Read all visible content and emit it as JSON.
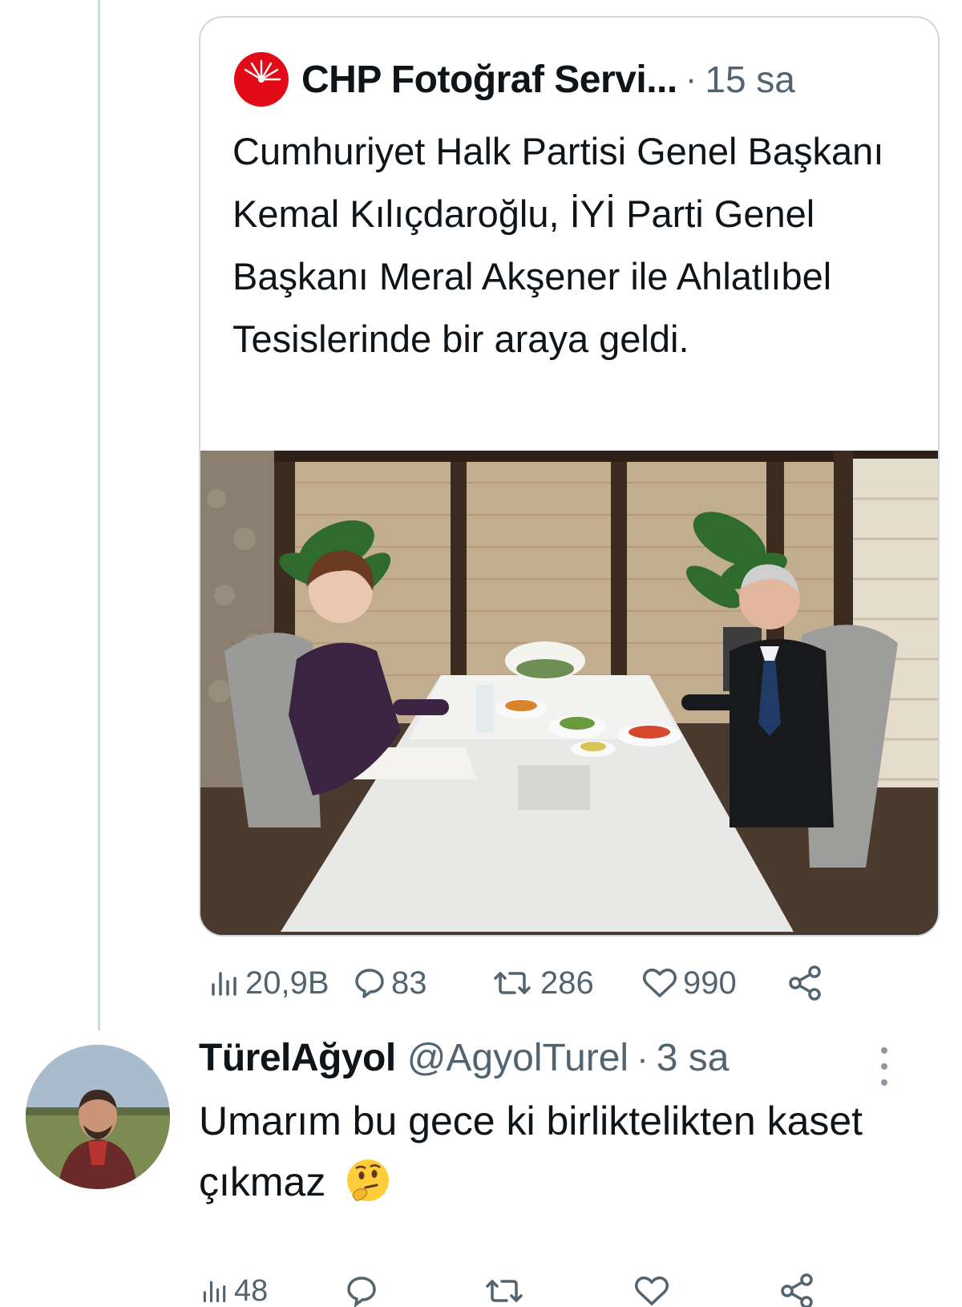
{
  "quoted_tweet": {
    "author_name": "CHP Fotoğraf Servi...",
    "separator": "·",
    "time": "15 sa",
    "text": "Cumhuriyet Halk Partisi Genel Başkanı Kemal Kılıçdaroğlu, İYİ Parti Genel Başkanı Meral Akşener ile Ahlatlıbel Tesislerinde bir araya geldi.",
    "actions": {
      "views": "20,9B",
      "replies": "83",
      "retweets": "286",
      "likes": "990"
    },
    "icons": {
      "avatar": "chp-logo-icon",
      "views": "views-bar-icon",
      "replies": "comment-icon",
      "retweets": "retweet-icon",
      "likes": "heart-icon",
      "share": "share-icon"
    }
  },
  "reply_tweet": {
    "display_name": "TürelAğyol",
    "handle": "@AgyolTurel",
    "separator": "·",
    "time": "3 sa",
    "text": "Umarım bu gece ki birliktelikten kaset çıkmaz",
    "emoji": "thinking-face-icon",
    "actions": {
      "views": "48"
    }
  },
  "colors": {
    "secondary_text": "#536471",
    "border": "#cfd9de",
    "chp_red": "#e30a17"
  }
}
